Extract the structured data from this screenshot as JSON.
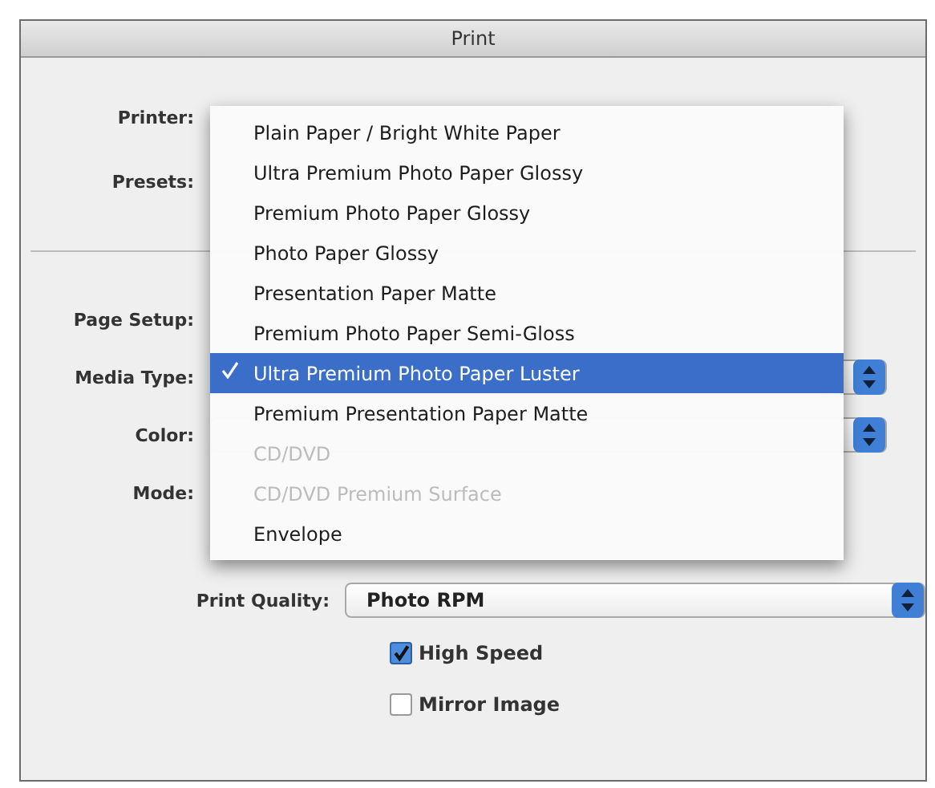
{
  "window": {
    "title": "Print"
  },
  "top_fields": [
    {
      "label": "Printer:"
    },
    {
      "label": "Presets:"
    }
  ],
  "settings": [
    {
      "label": "Page Setup:",
      "kind": "label"
    },
    {
      "label": "Media Type:",
      "kind": "popup"
    },
    {
      "label": "Color:",
      "kind": "popup"
    },
    {
      "label": "Mode:",
      "kind": "label"
    }
  ],
  "media_menu": {
    "items": [
      {
        "label": "Plain Paper / Bright White Paper",
        "selected": false,
        "disabled": false
      },
      {
        "label": "Ultra Premium Photo Paper Glossy",
        "selected": false,
        "disabled": false
      },
      {
        "label": "Premium Photo Paper Glossy",
        "selected": false,
        "disabled": false
      },
      {
        "label": "Photo Paper Glossy",
        "selected": false,
        "disabled": false
      },
      {
        "label": "Presentation Paper Matte",
        "selected": false,
        "disabled": false
      },
      {
        "label": "Premium Photo Paper Semi-Gloss",
        "selected": false,
        "disabled": false
      },
      {
        "label": "Ultra Premium Photo Paper Luster",
        "selected": true,
        "disabled": false
      },
      {
        "label": "Premium Presentation Paper Matte",
        "selected": false,
        "disabled": false
      },
      {
        "label": "CD/DVD",
        "selected": false,
        "disabled": true
      },
      {
        "label": "CD/DVD Premium Surface",
        "selected": false,
        "disabled": true
      },
      {
        "label": "Envelope",
        "selected": false,
        "disabled": false
      }
    ]
  },
  "print_quality": {
    "label": "Print Quality:",
    "value": "Photo RPM"
  },
  "options": [
    {
      "label": "High Speed",
      "checked": true
    },
    {
      "label": "Mirror Image",
      "checked": false
    }
  ]
}
